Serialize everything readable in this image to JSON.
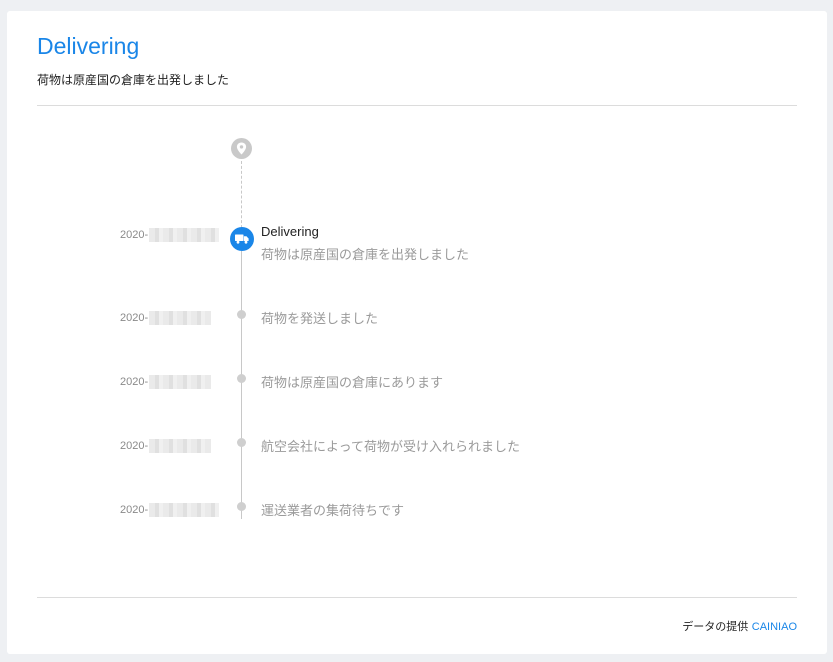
{
  "header": {
    "title": "Delivering",
    "subtitle": "荷物は原産国の倉庫を出発しました"
  },
  "timeline": {
    "start_icon": "location-pin-icon",
    "current_icon": "truck-icon",
    "events": [
      {
        "date": "2020-",
        "status": "Delivering",
        "description": "荷物は原産国の倉庫を出発しました",
        "current": true
      },
      {
        "date": "2020-",
        "description": "荷物を発送しました"
      },
      {
        "date": "2020-",
        "description": "荷物は原産国の倉庫にあります"
      },
      {
        "date": "2020-",
        "description": "航空会社によって荷物が受け入れられました"
      },
      {
        "date": "2020-",
        "description": "運送業者の集荷待ちです"
      }
    ]
  },
  "footer": {
    "provided_by": "データの提供",
    "provider": "CAINIAO"
  },
  "colors": {
    "accent": "#1a86e8",
    "muted_text": "#9a9a9a",
    "rail": "#c8c8c8",
    "background": "#eef0f3"
  }
}
